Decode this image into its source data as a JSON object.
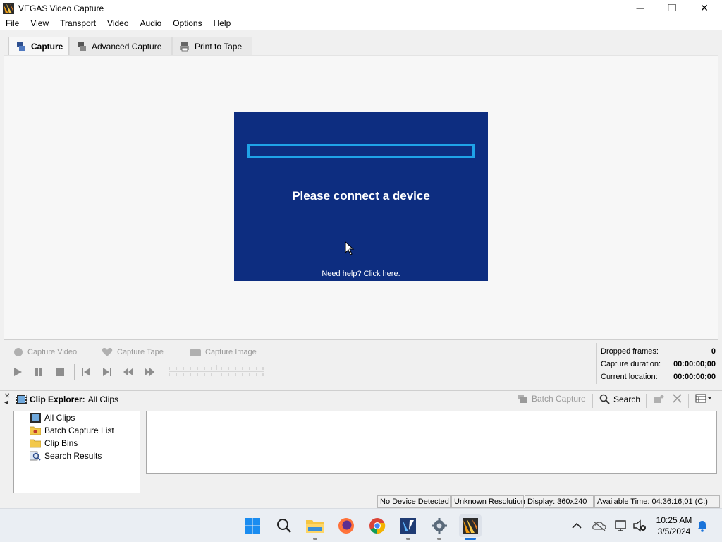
{
  "window": {
    "title": "VEGAS Video Capture",
    "controls": {
      "minimize": "—",
      "maximize": "❐",
      "close": "✕"
    }
  },
  "menu": [
    "File",
    "View",
    "Transport",
    "Video",
    "Audio",
    "Options",
    "Help"
  ],
  "tabs": [
    {
      "label": "Capture",
      "active": true
    },
    {
      "label": "Advanced Capture",
      "active": false
    },
    {
      "label": "Print to Tape",
      "active": false
    }
  ],
  "preview": {
    "message": "Please connect a device",
    "help_link": "Need help?  Click here.",
    "background": "#0d2d80",
    "bar_color": "#1fa3e8"
  },
  "capture_buttons": {
    "video": "Capture Video",
    "tape": "Capture Tape",
    "image": "Capture Image"
  },
  "stats": {
    "dropped_frames_label": "Dropped frames:",
    "dropped_frames": "0",
    "capture_duration_label": "Capture duration:",
    "capture_duration": "00:00:00;00",
    "current_location_label": "Current location:",
    "current_location": "00:00:00;00"
  },
  "clip_explorer": {
    "title": "Clip Explorer:",
    "scope": "All Clips",
    "batch_capture": "Batch Capture",
    "search": "Search",
    "tree": [
      "All Clips",
      "Batch Capture List",
      "Clip Bins",
      "Search Results"
    ]
  },
  "status": {
    "device": "No Device Detected",
    "resolution": "Unknown Resolution",
    "display": "Display: 360x240",
    "available": "Available Time: 04:36:16;01 (C:)"
  },
  "taskbar": {
    "apps": [
      "start",
      "search",
      "file-explorer",
      "firefox",
      "chrome",
      "vegas-pro",
      "settings",
      "vegas-capture"
    ],
    "time": "10:25 AM",
    "date": "3/5/2024"
  }
}
